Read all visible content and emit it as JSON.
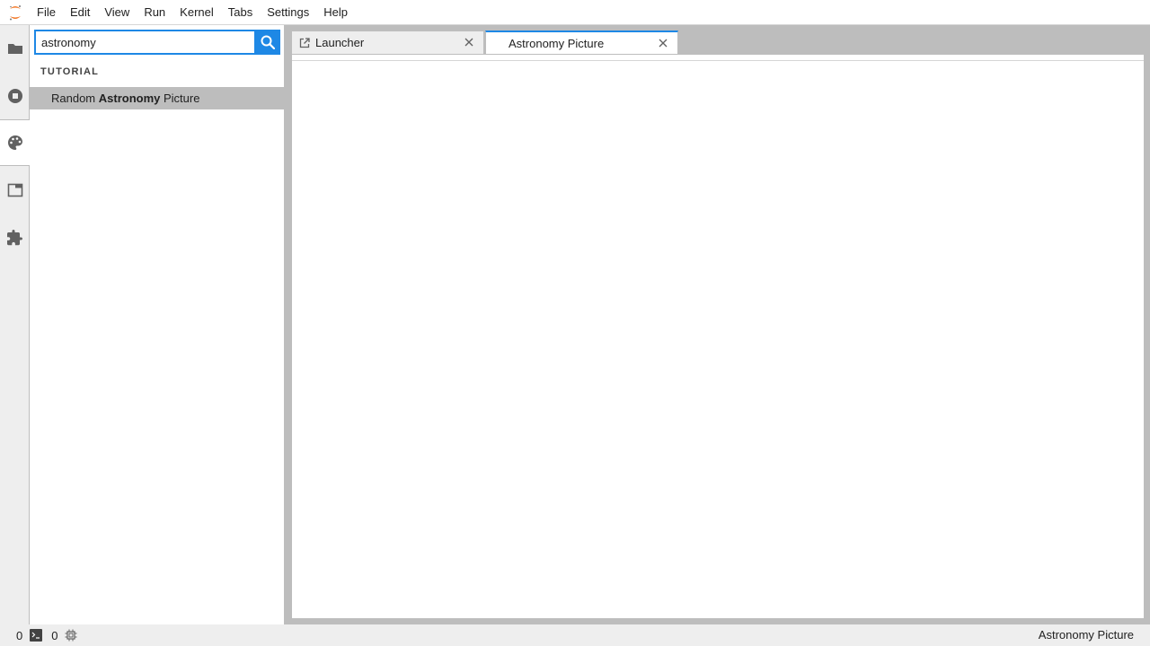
{
  "menubar": {
    "logo_icon": "jupyter-logo-icon",
    "items": [
      "File",
      "Edit",
      "View",
      "Run",
      "Kernel",
      "Tabs",
      "Settings",
      "Help"
    ]
  },
  "sidebar": {
    "tabs": [
      {
        "icon": "folder-icon",
        "active": false
      },
      {
        "icon": "stop-circle-icon",
        "active": false
      },
      {
        "icon": "palette-icon",
        "active": true
      },
      {
        "icon": "tab-window-icon",
        "active": false
      },
      {
        "icon": "extension-puzzle-icon",
        "active": false
      }
    ]
  },
  "palette": {
    "search_value": "astronomy",
    "search_icon": "search-icon",
    "category": "TUTORIAL",
    "result": {
      "before": "Random ",
      "match": "Astronomy",
      "after": " Picture"
    }
  },
  "tabs": [
    {
      "label": "Launcher",
      "icon": "launch-icon",
      "active": false
    },
    {
      "label": "Astronomy Picture",
      "icon": "",
      "active": true
    }
  ],
  "statusbar": {
    "terminals_count": "0",
    "kernels_count": "0",
    "terminal_icon": "terminal-icon",
    "kernel_icon": "cpu-icon",
    "current_activity": "Astronomy Picture"
  },
  "colors": {
    "accent": "#1e88e5",
    "panel_bg": "#eeeeee",
    "border": "#bdbdbd",
    "jupyter_orange": "#f37726"
  }
}
